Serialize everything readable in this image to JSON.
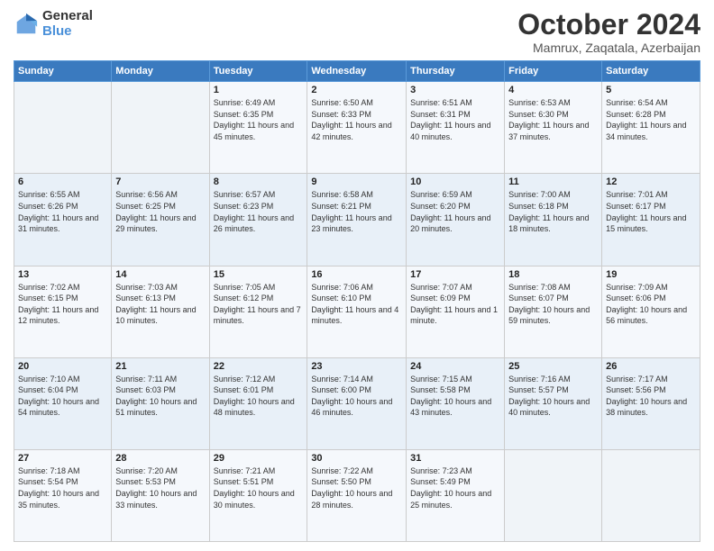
{
  "logo": {
    "general": "General",
    "blue": "Blue"
  },
  "title": "October 2024",
  "location": "Mamrux, Zaqatala, Azerbaijan",
  "days_of_week": [
    "Sunday",
    "Monday",
    "Tuesday",
    "Wednesday",
    "Thursday",
    "Friday",
    "Saturday"
  ],
  "weeks": [
    [
      {
        "day": "",
        "sunrise": "",
        "sunset": "",
        "daylight": ""
      },
      {
        "day": "",
        "sunrise": "",
        "sunset": "",
        "daylight": ""
      },
      {
        "day": "1",
        "sunrise": "Sunrise: 6:49 AM",
        "sunset": "Sunset: 6:35 PM",
        "daylight": "Daylight: 11 hours and 45 minutes."
      },
      {
        "day": "2",
        "sunrise": "Sunrise: 6:50 AM",
        "sunset": "Sunset: 6:33 PM",
        "daylight": "Daylight: 11 hours and 42 minutes."
      },
      {
        "day": "3",
        "sunrise": "Sunrise: 6:51 AM",
        "sunset": "Sunset: 6:31 PM",
        "daylight": "Daylight: 11 hours and 40 minutes."
      },
      {
        "day": "4",
        "sunrise": "Sunrise: 6:53 AM",
        "sunset": "Sunset: 6:30 PM",
        "daylight": "Daylight: 11 hours and 37 minutes."
      },
      {
        "day": "5",
        "sunrise": "Sunrise: 6:54 AM",
        "sunset": "Sunset: 6:28 PM",
        "daylight": "Daylight: 11 hours and 34 minutes."
      }
    ],
    [
      {
        "day": "6",
        "sunrise": "Sunrise: 6:55 AM",
        "sunset": "Sunset: 6:26 PM",
        "daylight": "Daylight: 11 hours and 31 minutes."
      },
      {
        "day": "7",
        "sunrise": "Sunrise: 6:56 AM",
        "sunset": "Sunset: 6:25 PM",
        "daylight": "Daylight: 11 hours and 29 minutes."
      },
      {
        "day": "8",
        "sunrise": "Sunrise: 6:57 AM",
        "sunset": "Sunset: 6:23 PM",
        "daylight": "Daylight: 11 hours and 26 minutes."
      },
      {
        "day": "9",
        "sunrise": "Sunrise: 6:58 AM",
        "sunset": "Sunset: 6:21 PM",
        "daylight": "Daylight: 11 hours and 23 minutes."
      },
      {
        "day": "10",
        "sunrise": "Sunrise: 6:59 AM",
        "sunset": "Sunset: 6:20 PM",
        "daylight": "Daylight: 11 hours and 20 minutes."
      },
      {
        "day": "11",
        "sunrise": "Sunrise: 7:00 AM",
        "sunset": "Sunset: 6:18 PM",
        "daylight": "Daylight: 11 hours and 18 minutes."
      },
      {
        "day": "12",
        "sunrise": "Sunrise: 7:01 AM",
        "sunset": "Sunset: 6:17 PM",
        "daylight": "Daylight: 11 hours and 15 minutes."
      }
    ],
    [
      {
        "day": "13",
        "sunrise": "Sunrise: 7:02 AM",
        "sunset": "Sunset: 6:15 PM",
        "daylight": "Daylight: 11 hours and 12 minutes."
      },
      {
        "day": "14",
        "sunrise": "Sunrise: 7:03 AM",
        "sunset": "Sunset: 6:13 PM",
        "daylight": "Daylight: 11 hours and 10 minutes."
      },
      {
        "day": "15",
        "sunrise": "Sunrise: 7:05 AM",
        "sunset": "Sunset: 6:12 PM",
        "daylight": "Daylight: 11 hours and 7 minutes."
      },
      {
        "day": "16",
        "sunrise": "Sunrise: 7:06 AM",
        "sunset": "Sunset: 6:10 PM",
        "daylight": "Daylight: 11 hours and 4 minutes."
      },
      {
        "day": "17",
        "sunrise": "Sunrise: 7:07 AM",
        "sunset": "Sunset: 6:09 PM",
        "daylight": "Daylight: 11 hours and 1 minute."
      },
      {
        "day": "18",
        "sunrise": "Sunrise: 7:08 AM",
        "sunset": "Sunset: 6:07 PM",
        "daylight": "Daylight: 10 hours and 59 minutes."
      },
      {
        "day": "19",
        "sunrise": "Sunrise: 7:09 AM",
        "sunset": "Sunset: 6:06 PM",
        "daylight": "Daylight: 10 hours and 56 minutes."
      }
    ],
    [
      {
        "day": "20",
        "sunrise": "Sunrise: 7:10 AM",
        "sunset": "Sunset: 6:04 PM",
        "daylight": "Daylight: 10 hours and 54 minutes."
      },
      {
        "day": "21",
        "sunrise": "Sunrise: 7:11 AM",
        "sunset": "Sunset: 6:03 PM",
        "daylight": "Daylight: 10 hours and 51 minutes."
      },
      {
        "day": "22",
        "sunrise": "Sunrise: 7:12 AM",
        "sunset": "Sunset: 6:01 PM",
        "daylight": "Daylight: 10 hours and 48 minutes."
      },
      {
        "day": "23",
        "sunrise": "Sunrise: 7:14 AM",
        "sunset": "Sunset: 6:00 PM",
        "daylight": "Daylight: 10 hours and 46 minutes."
      },
      {
        "day": "24",
        "sunrise": "Sunrise: 7:15 AM",
        "sunset": "Sunset: 5:58 PM",
        "daylight": "Daylight: 10 hours and 43 minutes."
      },
      {
        "day": "25",
        "sunrise": "Sunrise: 7:16 AM",
        "sunset": "Sunset: 5:57 PM",
        "daylight": "Daylight: 10 hours and 40 minutes."
      },
      {
        "day": "26",
        "sunrise": "Sunrise: 7:17 AM",
        "sunset": "Sunset: 5:56 PM",
        "daylight": "Daylight: 10 hours and 38 minutes."
      }
    ],
    [
      {
        "day": "27",
        "sunrise": "Sunrise: 7:18 AM",
        "sunset": "Sunset: 5:54 PM",
        "daylight": "Daylight: 10 hours and 35 minutes."
      },
      {
        "day": "28",
        "sunrise": "Sunrise: 7:20 AM",
        "sunset": "Sunset: 5:53 PM",
        "daylight": "Daylight: 10 hours and 33 minutes."
      },
      {
        "day": "29",
        "sunrise": "Sunrise: 7:21 AM",
        "sunset": "Sunset: 5:51 PM",
        "daylight": "Daylight: 10 hours and 30 minutes."
      },
      {
        "day": "30",
        "sunrise": "Sunrise: 7:22 AM",
        "sunset": "Sunset: 5:50 PM",
        "daylight": "Daylight: 10 hours and 28 minutes."
      },
      {
        "day": "31",
        "sunrise": "Sunrise: 7:23 AM",
        "sunset": "Sunset: 5:49 PM",
        "daylight": "Daylight: 10 hours and 25 minutes."
      },
      {
        "day": "",
        "sunrise": "",
        "sunset": "",
        "daylight": ""
      },
      {
        "day": "",
        "sunrise": "",
        "sunset": "",
        "daylight": ""
      }
    ]
  ]
}
